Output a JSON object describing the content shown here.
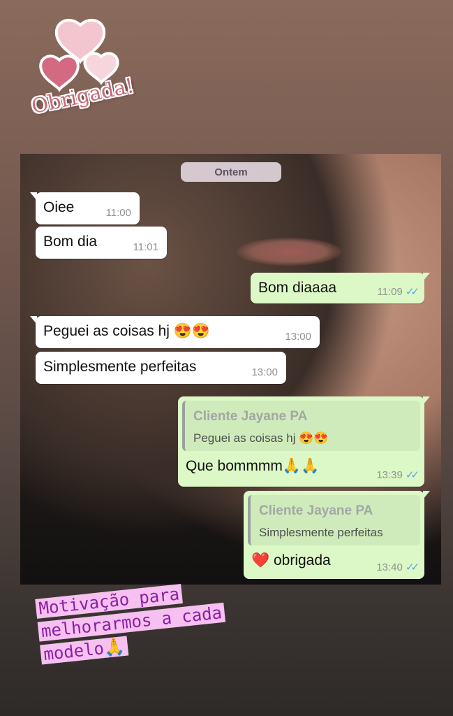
{
  "sticker": {
    "text": "Obrigada!",
    "icon": "hearts-icon"
  },
  "chat": {
    "date_chip": "Ontem",
    "messages": [
      {
        "text": "Oiee",
        "time": "11:00"
      },
      {
        "text": "Bom dia",
        "time": "11:01"
      },
      {
        "text": "Bom diaaaa",
        "time": "11:09"
      },
      {
        "text": "Peguei as coisas hj 😍😍",
        "time": "13:00"
      },
      {
        "text": "Simplesmente perfeitas",
        "time": "13:00"
      },
      {
        "quote_name": "Cliente Jayane PA",
        "quote_text": "Peguei as coisas hj 😍😍",
        "text": "Que bommmm🙏🙏",
        "time": "13:39"
      },
      {
        "quote_name": "Cliente Jayane PA",
        "quote_text": "Simplesmente perfeitas",
        "text": "❤️ obrigada",
        "time": "13:40"
      }
    ],
    "read_ticks": "✓✓"
  },
  "caption": {
    "line1": "Motivação para",
    "line2": "melhorarmos a cada",
    "line3": "modelo🙏"
  },
  "colors": {
    "outgoing": "#dcf8c6",
    "incoming": "#ffffff",
    "ticks": "#4fa9e4",
    "caption": "#8c1fa6",
    "caption_bg": "#f6c0f0"
  }
}
